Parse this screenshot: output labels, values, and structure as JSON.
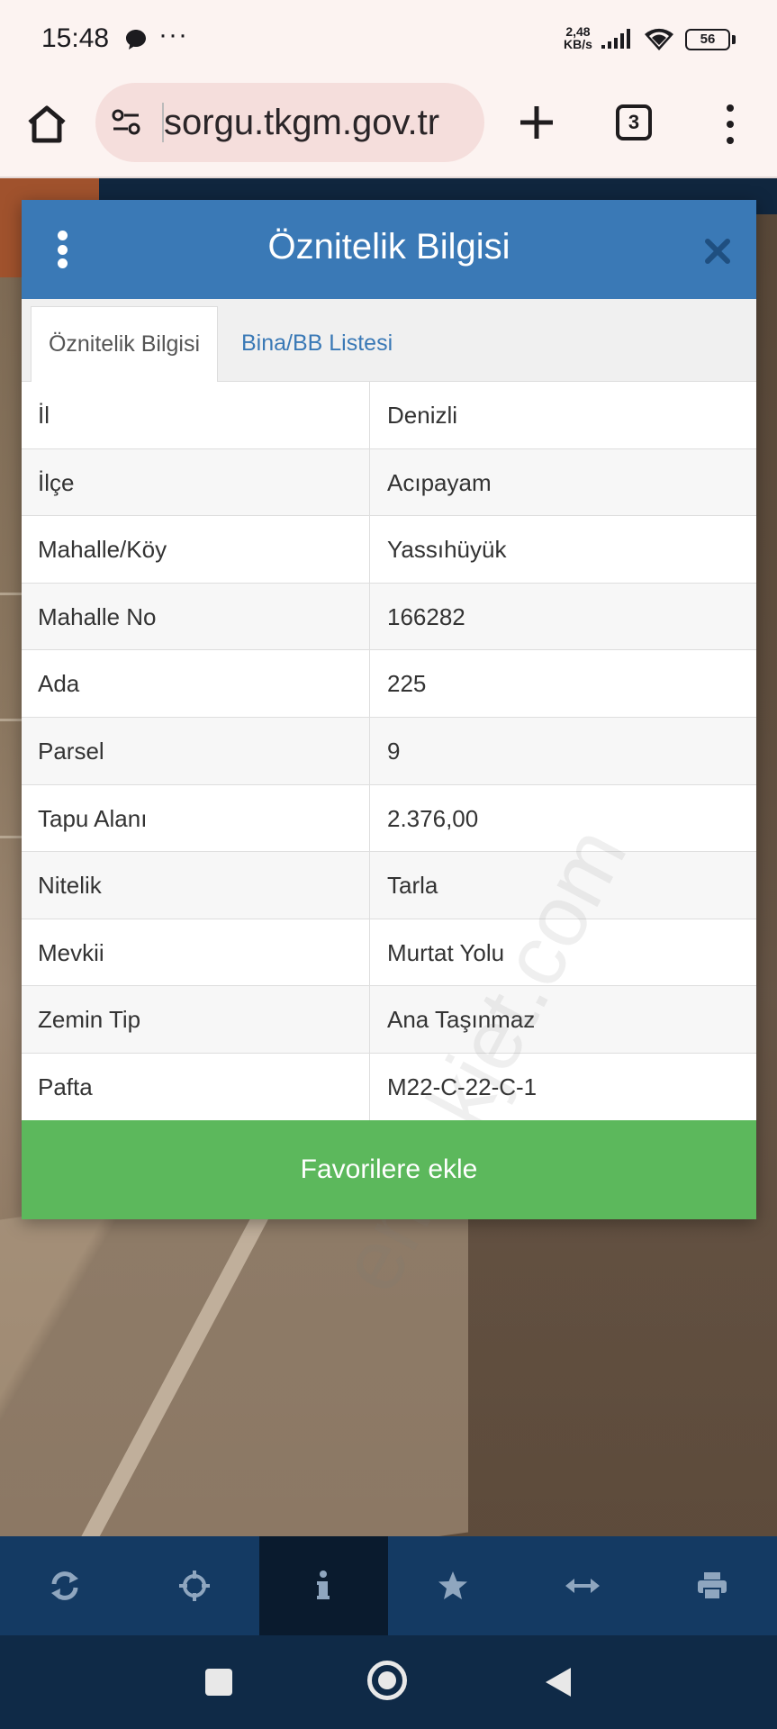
{
  "status_bar": {
    "time": "15:48",
    "net_speed_value": "2,48",
    "net_speed_unit": "KB/s",
    "battery": "56"
  },
  "browser": {
    "url": "sorgu.tkgm.gov.tr",
    "tab_count": "3"
  },
  "modal": {
    "title": "Öznitelik Bilgisi",
    "tabs": [
      {
        "label": "Öznitelik Bilgisi",
        "active": true
      },
      {
        "label": "Bina/BB Listesi",
        "active": false
      }
    ],
    "rows": [
      {
        "label": "İl",
        "value": "Denizli"
      },
      {
        "label": "İlçe",
        "value": "Acıpayam"
      },
      {
        "label": "Mahalle/Köy",
        "value": "Yassıhüyük"
      },
      {
        "label": "Mahalle No",
        "value": "166282"
      },
      {
        "label": "Ada",
        "value": "225"
      },
      {
        "label": "Parsel",
        "value": "9"
      },
      {
        "label": "Tapu Alanı",
        "value": "2.376,00"
      },
      {
        "label": "Nitelik",
        "value": "Tarla"
      },
      {
        "label": "Mevkii",
        "value": "Murtat Yolu"
      },
      {
        "label": "Zemin Tip",
        "value": "Ana Taşınmaz"
      },
      {
        "label": "Pafta",
        "value": "M22-C-22-C-1"
      }
    ],
    "favorite_button": "Favorilere ekle",
    "watermark": "emlakjet.com"
  },
  "toolbar": {
    "items": [
      {
        "icon": "refresh-icon",
        "active": false
      },
      {
        "icon": "locate-icon",
        "active": false
      },
      {
        "icon": "info-icon",
        "active": true
      },
      {
        "icon": "star-icon",
        "active": false
      },
      {
        "icon": "measure-icon",
        "active": false
      },
      {
        "icon": "print-icon",
        "active": false
      }
    ]
  },
  "colors": {
    "header_blue": "#3a79b6",
    "favorite_green": "#5cb85c",
    "toolbar_navy": "#143a63"
  }
}
